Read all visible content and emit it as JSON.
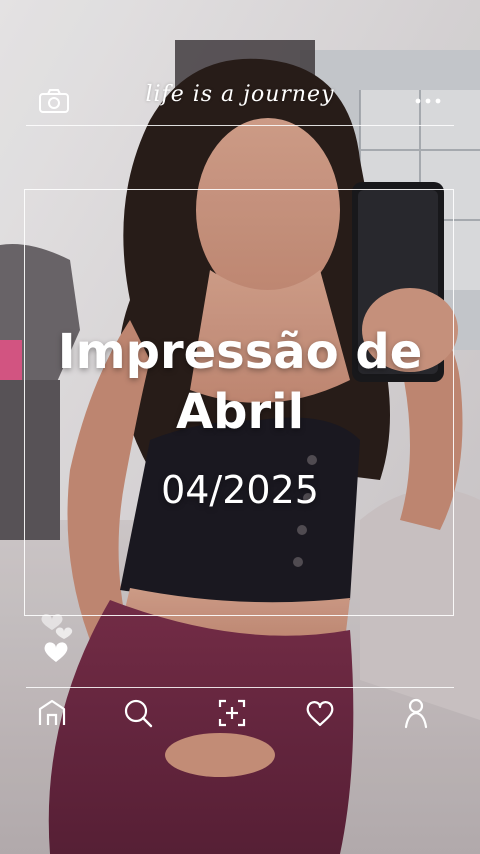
{
  "header": {
    "tagline": "life is a journey",
    "camera_icon": "camera-icon",
    "more_icon": "more-dots-icon"
  },
  "card": {
    "title_line1": "Impressão de",
    "title_line2": "Abril",
    "date": "04/2025"
  },
  "reactions": {
    "icon": "hearts-icon"
  },
  "bottom_nav": {
    "items": [
      {
        "icon": "home-icon"
      },
      {
        "icon": "search-icon"
      },
      {
        "icon": "add-post-icon"
      },
      {
        "icon": "heart-icon"
      },
      {
        "icon": "profile-icon"
      }
    ]
  },
  "colors": {
    "overlay": "#ffffff",
    "wall": "#e9e6e7",
    "top": "#1c1a22",
    "pants": "#6e2a44",
    "hair": "#2a1e1a"
  }
}
